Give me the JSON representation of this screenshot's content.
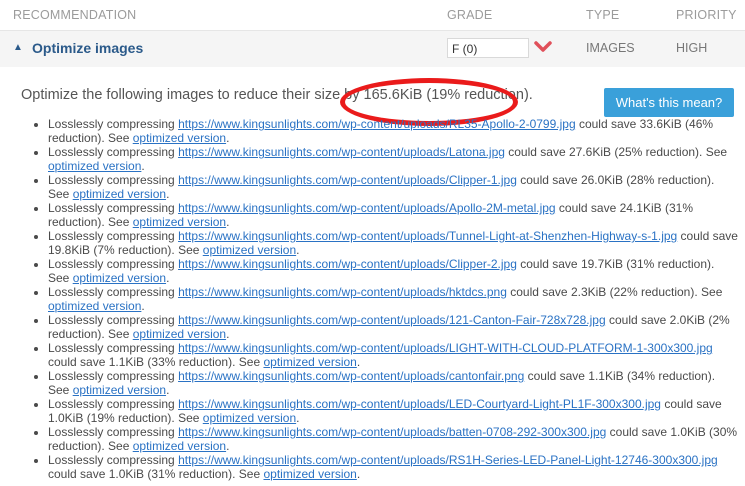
{
  "header": {
    "recommendation": "RECOMMENDATION",
    "grade": "GRADE",
    "type": "TYPE",
    "priority": "PRIORITY"
  },
  "row": {
    "title": "Optimize images",
    "grade_value": "F (0)",
    "type": "IMAGES",
    "priority": "HIGH"
  },
  "detail": {
    "summary_prefix": "Optimize the following images to reduce their size by ",
    "summary_highlight": "165.6KiB (19% reduction).",
    "whats_button": "What's this mean?",
    "lead": "Losslessly compressing ",
    "see": "See ",
    "optimized": "optimized version",
    "items": [
      {
        "url": "https://www.kingsunlights.com/wp-content/uploads/RL35-Apollo-2-0799.jpg",
        "save": " could save 33.6KiB (46% reduction). "
      },
      {
        "url": "https://www.kingsunlights.com/wp-content/uploads/Latona.jpg",
        "save": " could save 27.6KiB (25% reduction). "
      },
      {
        "url": "https://www.kingsunlights.com/wp-content/uploads/Clipper-1.jpg",
        "save": " could save 26.0KiB (28% reduction). "
      },
      {
        "url": "https://www.kingsunlights.com/wp-content/uploads/Apollo-2M-metal.jpg",
        "save": " could save 24.1KiB (31% reduction). "
      },
      {
        "url": "https://www.kingsunlights.com/wp-content/uploads/Tunnel-Light-at-Shenzhen-Highway-s-1.jpg",
        "save": " could save 19.8KiB (7% reduction). "
      },
      {
        "url": "https://www.kingsunlights.com/wp-content/uploads/Clipper-2.jpg",
        "save": " could save 19.7KiB (31% reduction). "
      },
      {
        "url": "https://www.kingsunlights.com/wp-content/uploads/hktdcs.png",
        "save": " could save 2.3KiB (22% reduction). "
      },
      {
        "url": "https://www.kingsunlights.com/wp-content/uploads/121-Canton-Fair-728x728.jpg",
        "save": " could save 2.0KiB (2% reduction). "
      },
      {
        "url": "https://www.kingsunlights.com/wp-content/uploads/LIGHT-WITH-CLOUD-PLATFORM-1-300x300.jpg",
        "save": " could save 1.1KiB (33% reduction). "
      },
      {
        "url": "https://www.kingsunlights.com/wp-content/uploads/cantonfair.png",
        "save": " could save 1.1KiB (34% reduction). "
      },
      {
        "url": "https://www.kingsunlights.com/wp-content/uploads/LED-Courtyard-Light-PL1F-300x300.jpg",
        "save": " could save 1.0KiB (19% reduction). "
      },
      {
        "url": "https://www.kingsunlights.com/wp-content/uploads/batten-0708-292-300x300.jpg",
        "save": " could save 1.0KiB (30% reduction). "
      },
      {
        "url": "https://www.kingsunlights.com/wp-content/uploads/RS1H-Series-LED-Panel-Light-12746-300x300.jpg",
        "save": " could save 1.0KiB (31% reduction). "
      }
    ]
  },
  "colors": {
    "link": "#2a72c4",
    "title": "#2b5a8a",
    "button": "#3aa0da",
    "highlight_circle": "#ea1b1b",
    "chevron": "#e0505a"
  }
}
